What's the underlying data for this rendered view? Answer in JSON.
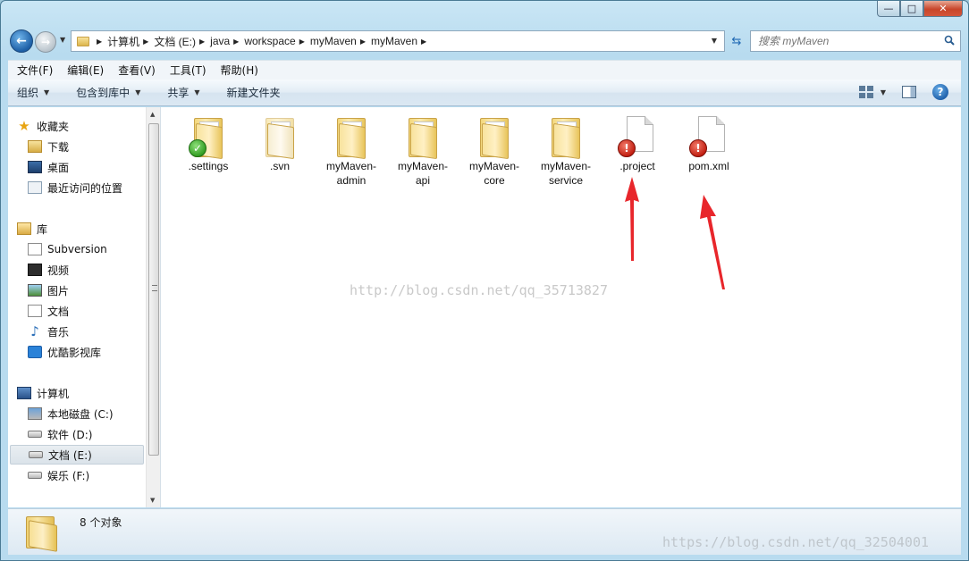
{
  "window": {
    "caption": {
      "minimize": "—",
      "maximize": "□",
      "close": "✕"
    }
  },
  "address": {
    "crumbs": [
      "计算机",
      "文档 (E:)",
      "java",
      "workspace",
      "myMaven",
      "myMaven"
    ]
  },
  "search": {
    "placeholder": "搜索 myMaven"
  },
  "menubar": [
    "文件(F)",
    "编辑(E)",
    "查看(V)",
    "工具(T)",
    "帮助(H)"
  ],
  "commands": {
    "organize": "组织",
    "include_library": "包含到库中",
    "share": "共享",
    "new_folder": "新建文件夹"
  },
  "nav": {
    "favorites": {
      "label": "收藏夹",
      "items": [
        "下载",
        "桌面",
        "最近访问的位置"
      ]
    },
    "libraries": {
      "label": "库",
      "items": [
        "Subversion",
        "视频",
        "图片",
        "文档",
        "音乐",
        "优酷影视库"
      ]
    },
    "computer": {
      "label": "计算机",
      "items": [
        "本地磁盘 (C:)",
        "软件 (D:)",
        "文档 (E:)",
        "娱乐 (F:)"
      ],
      "selected": "文档 (E:)"
    }
  },
  "files": [
    {
      "name": ".settings",
      "kind": "folder",
      "badge": "ok"
    },
    {
      "name": ".svn",
      "kind": "folder-light",
      "badge": ""
    },
    {
      "name": "myMaven-admin",
      "kind": "folder",
      "badge": ""
    },
    {
      "name": "myMaven-api",
      "kind": "folder",
      "badge": ""
    },
    {
      "name": "myMaven-core",
      "kind": "folder",
      "badge": ""
    },
    {
      "name": "myMaven-service",
      "kind": "folder",
      "badge": ""
    },
    {
      "name": ".project",
      "kind": "file",
      "badge": "warn"
    },
    {
      "name": "pom.xml",
      "kind": "file",
      "badge": "warn"
    }
  ],
  "watermarks": [
    "http://blog.csdn.net/qq_35713827",
    "https://blog.csdn.net/qq_32504001"
  ],
  "status": {
    "count": "8 个对象"
  },
  "colors": {
    "arrow": "#e8262b",
    "badge_ok": "#2e9a1e",
    "badge_warn": "#c01b0e"
  }
}
